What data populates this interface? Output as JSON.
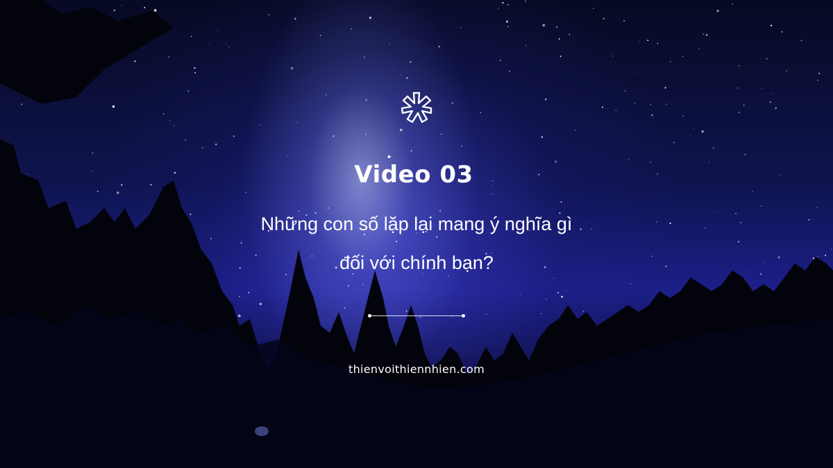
{
  "slide": {
    "logo_icon": "asterisk-logo-icon",
    "title": "Video 03",
    "subtitle_line1": "Những con số lặp lại mang ý nghĩa gì",
    "subtitle_line2": "đối với chính bạn?",
    "website": "thienvoithiennhien.com"
  },
  "colors": {
    "text": "#ffffff",
    "sky_deep": "#0f1450",
    "sky_glow": "#1c1f88",
    "forest": "#020208"
  }
}
